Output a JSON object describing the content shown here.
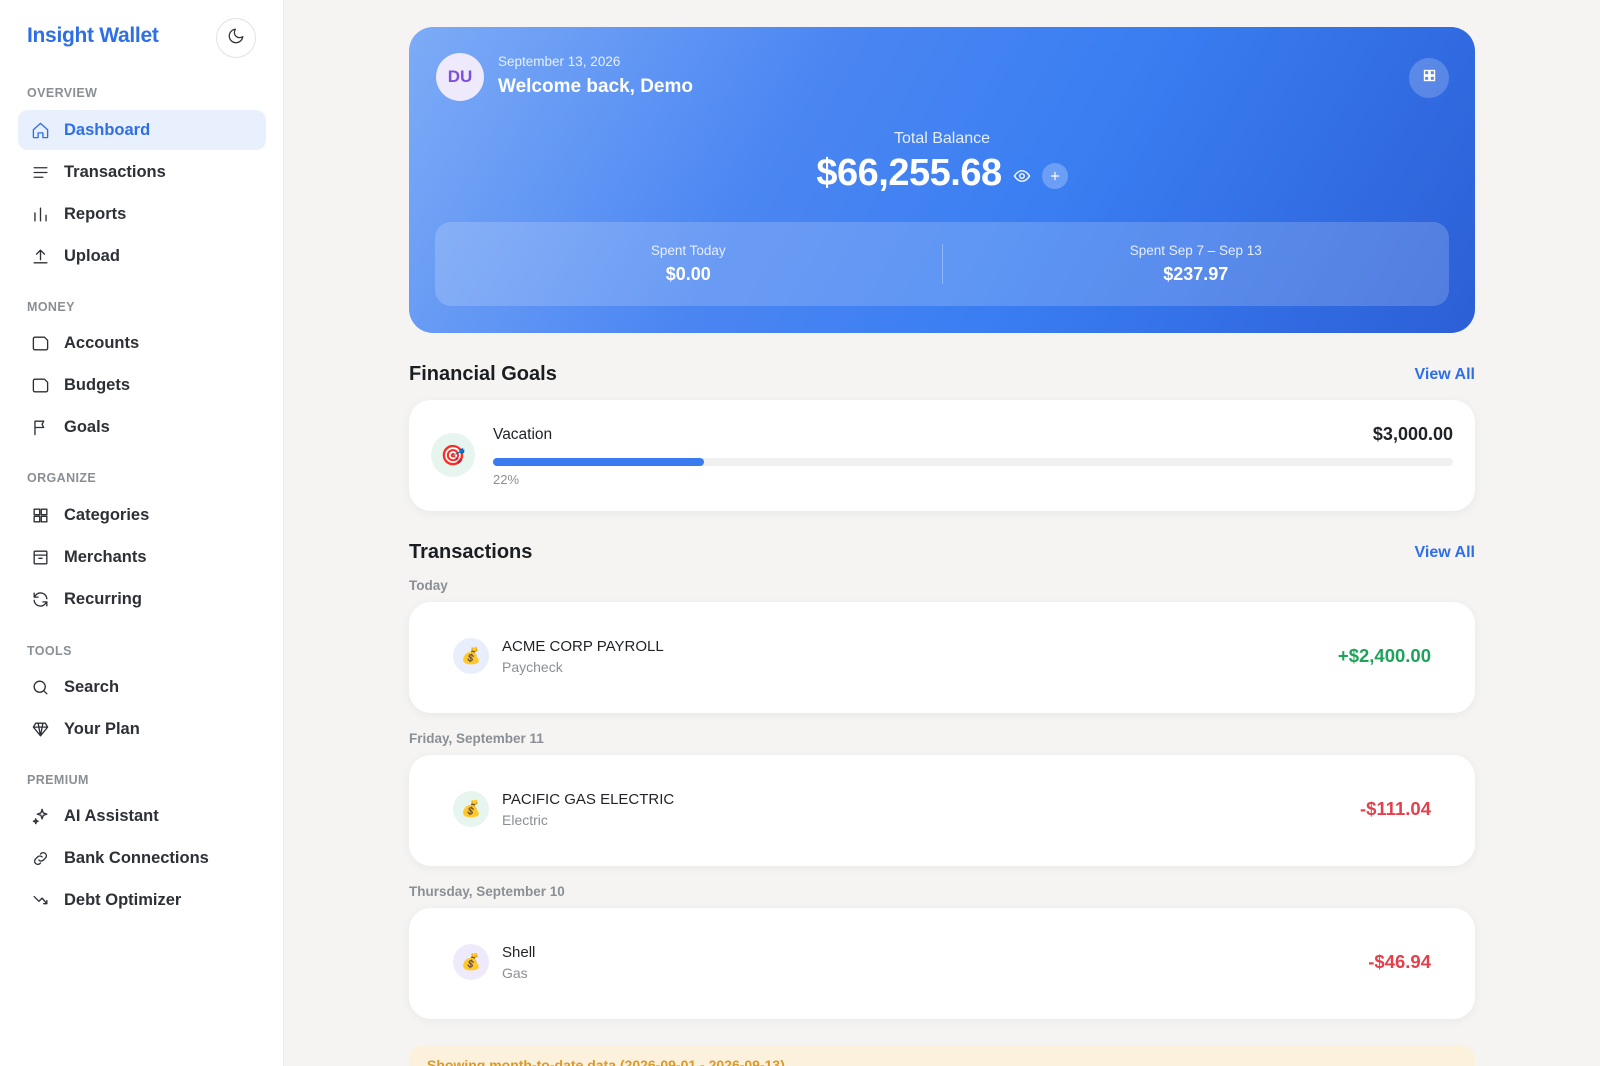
{
  "brand": "Insight Wallet",
  "sidebar": {
    "sections": [
      {
        "label": "OVERVIEW"
      },
      {
        "label": "MONEY"
      },
      {
        "label": "ORGANIZE"
      },
      {
        "label": "TOOLS"
      },
      {
        "label": "PREMIUM"
      }
    ],
    "items": [
      {
        "label": "Dashboard",
        "icon": "home-icon",
        "active": true
      },
      {
        "label": "Transactions",
        "icon": "list-icon"
      },
      {
        "label": "Reports",
        "icon": "bar-chart-icon"
      },
      {
        "label": "Upload",
        "icon": "upload-icon"
      },
      {
        "label": "Accounts",
        "icon": "folder-icon"
      },
      {
        "label": "Budgets",
        "icon": "folder-icon"
      },
      {
        "label": "Goals",
        "icon": "flag-icon"
      },
      {
        "label": "Categories",
        "icon": "grid-icon"
      },
      {
        "label": "Merchants",
        "icon": "archive-icon"
      },
      {
        "label": "Recurring",
        "icon": "refresh-icon"
      },
      {
        "label": "Search",
        "icon": "search-icon"
      },
      {
        "label": "Your Plan",
        "icon": "diamond-icon"
      },
      {
        "label": "AI Assistant",
        "icon": "sparkle-icon"
      },
      {
        "label": "Bank Connections",
        "icon": "link-icon"
      },
      {
        "label": "Debt Optimizer",
        "icon": "trend-down-icon"
      }
    ]
  },
  "hero": {
    "avatar_initials": "DU",
    "date": "September 13, 2026",
    "welcome": "Welcome back, Demo",
    "total_label": "Total Balance",
    "total_balance": "$66,255.68",
    "spent_today_label": "Spent Today",
    "spent_today_value": "$0.00",
    "spent_week_label": "Spent Sep 7 – Sep 13",
    "spent_week_value": "$237.97"
  },
  "goals": {
    "title": "Financial Goals",
    "view_all": "View All",
    "items": [
      {
        "name": "Vacation",
        "amount": "$3,000.00",
        "percent_label": "22%",
        "progress": 0.22
      }
    ]
  },
  "transactions": {
    "title": "Transactions",
    "view_all": "View All",
    "groups": [
      {
        "date": "Today",
        "items": [
          {
            "name": "ACME CORP PAYROLL",
            "category": "Paycheck",
            "amount": "+$2,400.00",
            "type": "income",
            "icon_bg": "#e8eefc"
          }
        ]
      },
      {
        "date": "Friday, September 11",
        "items": [
          {
            "name": "PACIFIC GAS ELECTRIC",
            "category": "Electric",
            "amount": "-$111.04",
            "type": "expense",
            "icon_bg": "#e7f5ef"
          }
        ]
      },
      {
        "date": "Thursday, September 10",
        "items": [
          {
            "name": "Shell",
            "category": "Gas",
            "amount": "-$46.94",
            "type": "expense",
            "icon_bg": "#efeafb"
          }
        ]
      }
    ]
  },
  "notice": "Showing month-to-date data (2026-09-01 - 2026-09-13)",
  "colors": {
    "accent": "#2f6fe6",
    "income": "#1fa35c",
    "expense": "#e2404a"
  }
}
